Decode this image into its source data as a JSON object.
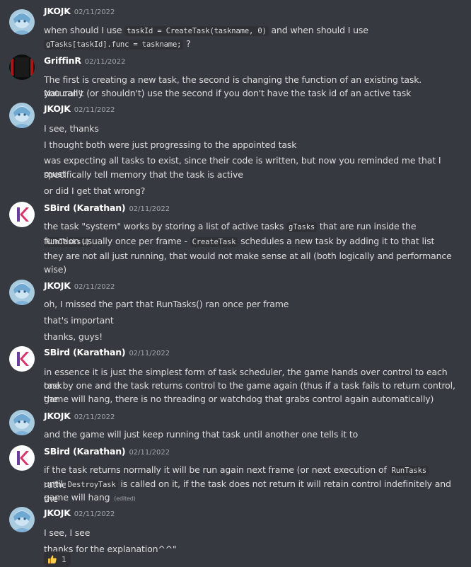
{
  "messages": [
    {
      "user": "JKOJK",
      "time": "02/11/2022",
      "avatar": "anime-avatar",
      "lines": [
        [
          {
            "t": "when should I use "
          },
          {
            "c": "taskId = CreateTask(taskname, 0)"
          },
          {
            "t": " and when should I use"
          }
        ],
        [
          {
            "c": "gTasks[taskId].func = taskname;"
          },
          {
            "t": " ?"
          }
        ]
      ]
    },
    {
      "user": "GriffinR",
      "time": "02/11/2022",
      "avatar": "red-black-avatar",
      "lines": [
        [
          {
            "t": "The first is creating a new task, the second is changing the function of an existing task. Naturally"
          }
        ],
        [
          {
            "t": "you can't (or shouldn't) use the second if you don't have the task id of an active task"
          }
        ]
      ]
    },
    {
      "user": "JKOJK",
      "time": "02/11/2022",
      "avatar": "anime-avatar",
      "lines": [
        [
          {
            "t": "I see, thanks"
          }
        ],
        [
          {
            "t": "I thought both were just progressing to the appointed task"
          }
        ],
        [
          {
            "t": "was expecting all tasks to exist, since their code is written, but now you reminded me that I must"
          }
        ],
        [
          {
            "t": "specifically tell memory that the task is active"
          }
        ],
        [
          {
            "t": "or did I get that wrong?"
          }
        ]
      ]
    },
    {
      "user": "SBird (Karathan)",
      "time": "02/11/2022",
      "avatar": "k-logo-avatar",
      "lines": [
        [
          {
            "t": "the task \"system\" works by storing a list of active tasks "
          },
          {
            "c": "gTasks"
          },
          {
            "t": " that are run inside the "
          },
          {
            "c": "RunTasks()"
          }
        ],
        [
          {
            "t": "function usually once per frame - "
          },
          {
            "c": "CreateTask"
          },
          {
            "t": " schedules a new task by adding it to that list"
          }
        ],
        [
          {
            "t": "they are not all just running, that would not make sense at all (both logically and performance"
          }
        ],
        [
          {
            "t": "wise)"
          }
        ]
      ]
    },
    {
      "user": "JKOJK",
      "time": "02/11/2022",
      "avatar": "anime-avatar",
      "lines": [
        [
          {
            "t": "oh, I missed the part that RunTasks() ran once per frame"
          }
        ],
        [
          {
            "t": "that's important"
          }
        ],
        [
          {
            "t": "thanks, guys!"
          }
        ]
      ]
    },
    {
      "user": "SBird (Karathan)",
      "time": "02/11/2022",
      "avatar": "k-logo-avatar",
      "lines": [
        [
          {
            "t": "in essence it is just the simplest form of task scheduler, the game hands over control to each task"
          }
        ],
        [
          {
            "t": "one by one and the task returns control to the game again (thus if a task fails to return control, the"
          }
        ],
        [
          {
            "t": "game will hang, there is no threading or watchdog that grabs control again automatically)"
          }
        ]
      ]
    },
    {
      "user": "JKOJK",
      "time": "02/11/2022",
      "avatar": "anime-avatar",
      "lines": [
        [
          {
            "t": "and the game will just keep running that task until another one tells it to"
          }
        ]
      ]
    },
    {
      "user": "SBird (Karathan)",
      "time": "02/11/2022",
      "avatar": "k-logo-avatar",
      "lines": [
        [
          {
            "t": "if the task returns normally it will be run again next frame (or next execution of "
          },
          {
            "c": "RunTasks"
          },
          {
            "t": " rather)"
          }
        ],
        [
          {
            "t": "until "
          },
          {
            "c": "DestroyTask"
          },
          {
            "t": " is called on it, if the task does not return it will retain control indefinitely and the"
          }
        ],
        [
          {
            "t": "game will hang "
          },
          {
            "e": "(edited)"
          }
        ]
      ]
    },
    {
      "user": "JKOJK",
      "time": "02/11/2022",
      "avatar": "anime-avatar",
      "lines": [
        [
          {
            "t": "I see, I see"
          }
        ],
        [
          {
            "t": "thanks for the explanation^^\""
          }
        ]
      ],
      "reaction": {
        "emoji": "thumbs-up-icon",
        "count": "1"
      }
    }
  ]
}
